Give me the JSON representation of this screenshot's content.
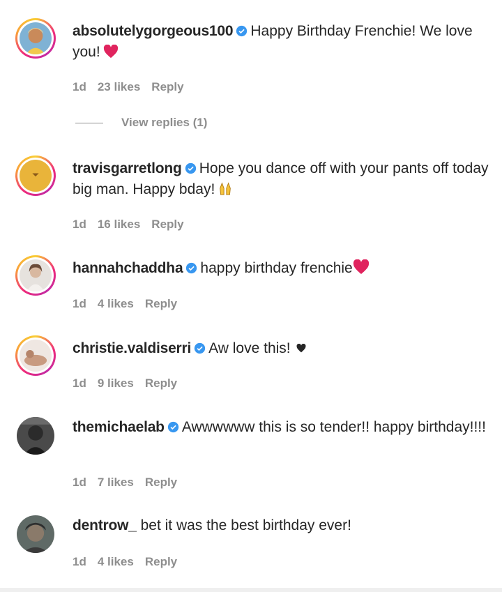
{
  "colors": {
    "verified_blue": "#3897f0",
    "muted": "#8e8e8e",
    "heart_red": "#e0245e"
  },
  "comments": [
    {
      "username": "absolutelygorgeous100",
      "verified": true,
      "text": "Happy Birthday Frenchie! We love you!",
      "emoji": "red-heart-icon",
      "time": "1d",
      "likes": "23 likes",
      "reply": "Reply",
      "view_replies": "View replies (1)"
    },
    {
      "username": "travisgarretlong",
      "verified": true,
      "text": "Hope you dance off with your pants off today big man. Happy bday!",
      "emoji": "raising-hands-icon",
      "time": "1d",
      "likes": "16 likes",
      "reply": "Reply"
    },
    {
      "username": "hannahchaddha",
      "verified": true,
      "text": "happy birthday frenchie",
      "emoji": "red-heart-icon",
      "time": "1d",
      "likes": "4 likes",
      "reply": "Reply"
    },
    {
      "username": "christie.valdiserri",
      "verified": true,
      "text": "Aw love this!",
      "emoji": "black-heart-icon",
      "time": "1d",
      "likes": "9 likes",
      "reply": "Reply"
    },
    {
      "username": "themichaelab",
      "verified": true,
      "text": "Awwwwww this is so tender!! happy birthday!!!!",
      "time": "1d",
      "likes": "7 likes",
      "reply": "Reply"
    },
    {
      "username": "dentrow_",
      "verified": false,
      "text": "bet it was the best birthday ever!",
      "time": "1d",
      "likes": "4 likes",
      "reply": "Reply"
    }
  ]
}
